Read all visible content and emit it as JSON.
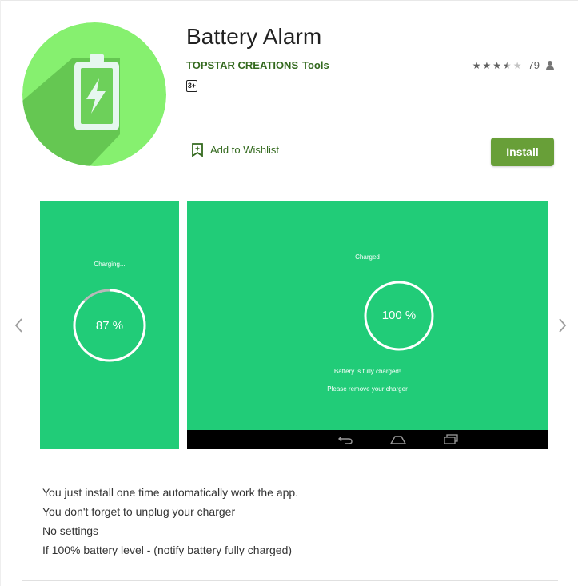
{
  "app": {
    "title": "Battery Alarm",
    "developer": "TOPSTAR CREATIONS",
    "category": "Tools",
    "rating_stars": 3.5,
    "rating_count": "79",
    "content_rating": "3+",
    "icon": "battery-charging-icon"
  },
  "actions": {
    "wishlist_label": "Add to Wishlist",
    "install_label": "Install"
  },
  "screenshots": [
    {
      "status_text": "Charging...",
      "percent_label": "87 %",
      "progress": 0.87
    },
    {
      "status_text": "Charged",
      "percent_label": "100 %",
      "progress": 1.0,
      "message_1": "Battery is fully charged!",
      "message_2": "Please remove your charger",
      "nav_icons": [
        "back-icon",
        "home-icon",
        "recents-icon"
      ]
    }
  ],
  "description": {
    "lines": [
      "You just install one time automatically work the app.",
      "You don't forget to unplug your charger",
      "No settings",
      "If 100% battery level - (notify battery fully charged)"
    ]
  },
  "colors": {
    "accent_green": "#33691e",
    "install_button": "#689f38",
    "screenshot_bg": "#21cc78",
    "icon_bg": "#86f06f"
  }
}
